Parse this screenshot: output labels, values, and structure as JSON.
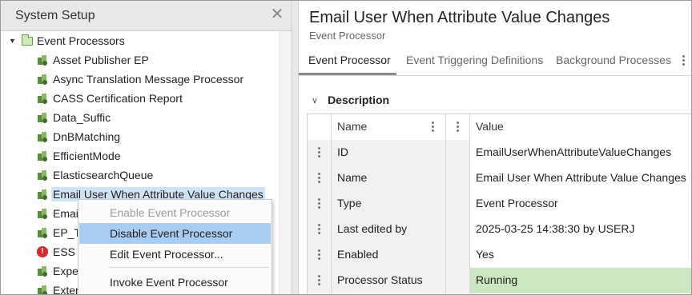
{
  "left_panel": {
    "title": "System Setup",
    "close_glyph": "✕",
    "root_label": "Event Processors",
    "items": [
      {
        "label": "Asset Publisher EP",
        "icon": "event-processor-icon"
      },
      {
        "label": "Async Translation Message Processor",
        "icon": "event-processor-icon"
      },
      {
        "label": "CASS Certification Report",
        "icon": "event-processor-icon"
      },
      {
        "label": "Data_Suffic",
        "icon": "event-processor-icon"
      },
      {
        "label": "DnBMatching",
        "icon": "event-processor-icon"
      },
      {
        "label": "EfficientMode",
        "icon": "event-processor-icon"
      },
      {
        "label": "ElasticsearchQueue",
        "icon": "event-processor-icon"
      },
      {
        "label": "Email User When Attribute Value Changes",
        "icon": "event-processor-icon"
      },
      {
        "label": "Email",
        "icon": "event-processor-icon"
      },
      {
        "label": "EP_T",
        "icon": "event-processor-icon"
      },
      {
        "label": "ESS",
        "icon": "error-icon"
      },
      {
        "label": "Expe",
        "icon": "event-processor-icon"
      },
      {
        "label": "Exter",
        "icon": "event-processor-icon"
      }
    ]
  },
  "context_menu": {
    "items": [
      {
        "label": "Enable Event Processor",
        "state": "disabled"
      },
      {
        "label": "Disable Event Processor",
        "state": "highlighted"
      },
      {
        "label": "Edit Event Processor...",
        "state": "normal"
      },
      {
        "label": "Invoke Event Processor",
        "state": "normal"
      }
    ]
  },
  "detail": {
    "title": "Email User When Attribute Value Changes",
    "subtitle": "Event Processor",
    "tabs": [
      "Event Processor",
      "Event Triggering Definitions",
      "Background Processes"
    ],
    "active_tab": "Event Processor",
    "section_title": "Description",
    "grid": {
      "columns": [
        "Name",
        "Value"
      ],
      "rows": [
        {
          "name": "ID",
          "value": "EmailUserWhenAttributeValueChanges"
        },
        {
          "name": "Name",
          "value": "Email User When Attribute Value Changes"
        },
        {
          "name": "Type",
          "value": "Event Processor"
        },
        {
          "name": "Last edited by",
          "value": "2025-03-25 14:38:30 by USERJ"
        },
        {
          "name": "Enabled",
          "value": "Yes"
        },
        {
          "name": "Processor Status",
          "value": "Running"
        }
      ]
    }
  },
  "colors": {
    "selection": "#cfe3f6",
    "menu_highlight": "#a9cdf2",
    "status_running": "#cce7c0",
    "error": "#d42a2a"
  }
}
